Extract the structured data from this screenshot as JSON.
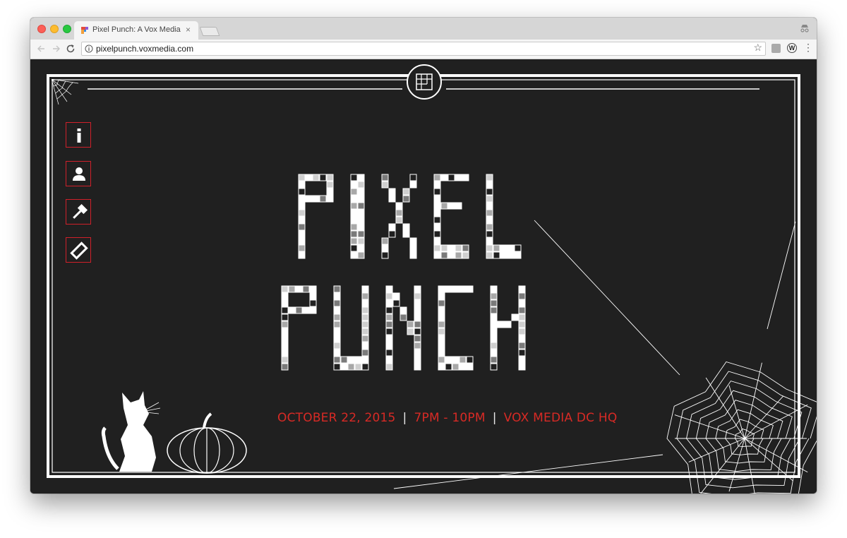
{
  "browser": {
    "tab_title": "Pixel Punch: A Vox Media Des",
    "tab_close": "×",
    "url": "pixelpunch.voxmedia.com"
  },
  "site": {
    "title_line1": "PIXEL",
    "title_line2": "PUNCH",
    "event": {
      "date": "OCTOBER 22, 2015",
      "separator": "|",
      "time": "7PM - 10PM",
      "location": "VOX MEDIA DC HQ"
    },
    "sidebar_icons": [
      "info-icon",
      "person-icon",
      "gavel-icon",
      "ticket-icon"
    ],
    "logo_icon": "grid-logo-icon",
    "decorations": [
      "cobweb-icon",
      "cat-silhouette-icon",
      "pumpkin-icon",
      "spiderweb-icon"
    ]
  },
  "colors": {
    "accent": "#d82a25",
    "background": "#202020",
    "frame": "#ffffff"
  }
}
